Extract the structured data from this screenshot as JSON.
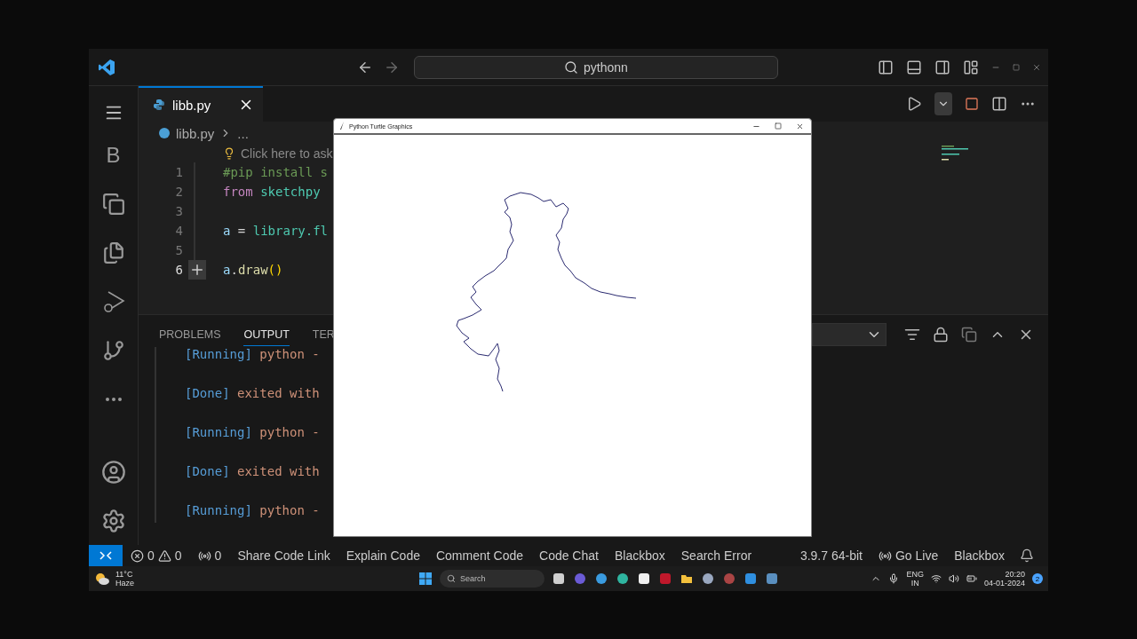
{
  "title_bar": {
    "search": "pythonn"
  },
  "activity_bar": {
    "letter": "B"
  },
  "tabs": [
    {
      "label": "libb.py",
      "selected": true
    }
  ],
  "breadcrumb": {
    "file": "libb.py",
    "rest": "..."
  },
  "hint": "Click here to ask",
  "code": [
    {
      "number": "1",
      "active": false,
      "tokens": [
        {
          "kind": "comment",
          "text": "#pip install s"
        }
      ]
    },
    {
      "number": "2",
      "active": false,
      "tokens": [
        {
          "kind": "keyword",
          "text": "from"
        },
        {
          "kind": "module",
          "text": " sketchpy"
        }
      ]
    },
    {
      "number": "3",
      "active": false
    },
    {
      "number": "4",
      "active": false,
      "tokens": [
        {
          "kind": "variable",
          "text": "a"
        },
        {
          "kind": "plain",
          "text": " = "
        },
        {
          "kind": "module",
          "text": "library.fl"
        }
      ]
    },
    {
      "number": "5",
      "active": false
    },
    {
      "number": "6",
      "active": true,
      "tokens": [
        {
          "kind": "variable",
          "text": "a"
        },
        {
          "kind": "plain",
          "text": "."
        },
        {
          "kind": "function",
          "text": "draw"
        },
        {
          "kind": "bracket",
          "text": "()"
        }
      ]
    }
  ],
  "panel": {
    "tabs": [
      {
        "label": "PROBLEMS",
        "selected": false
      },
      {
        "label": "OUTPUT",
        "selected": true
      },
      {
        "label": "TER",
        "selected": false
      }
    ],
    "lines": [
      {
        "tag": "[Running]",
        "text": "python -"
      },
      {
        "tag": "[Done]",
        "text": "exited with"
      },
      {
        "tag": "[Running]",
        "text": "python -"
      },
      {
        "tag": "[Done]",
        "text": "exited with"
      },
      {
        "tag": "[Running]",
        "text": "python -"
      }
    ]
  },
  "turtle_window": {
    "title": "Python Turtle Graphics"
  },
  "status_bar": {
    "errors": "0",
    "warnings": "0",
    "ports": "0",
    "left_items": [
      "Share Code Link",
      "Explain Code",
      "Comment Code",
      "Code Chat",
      "Blackbox",
      "Search Error"
    ],
    "version": "3.9.7 64-bit",
    "go_live": "Go Live",
    "right_item": "Blackbox"
  },
  "taskbar": {
    "temperature": "11°C",
    "weather": "Haze",
    "search": "Search",
    "language": "ENG",
    "region": "IN",
    "time": "20:20",
    "date": "04-01-2024",
    "notifications": "2"
  }
}
